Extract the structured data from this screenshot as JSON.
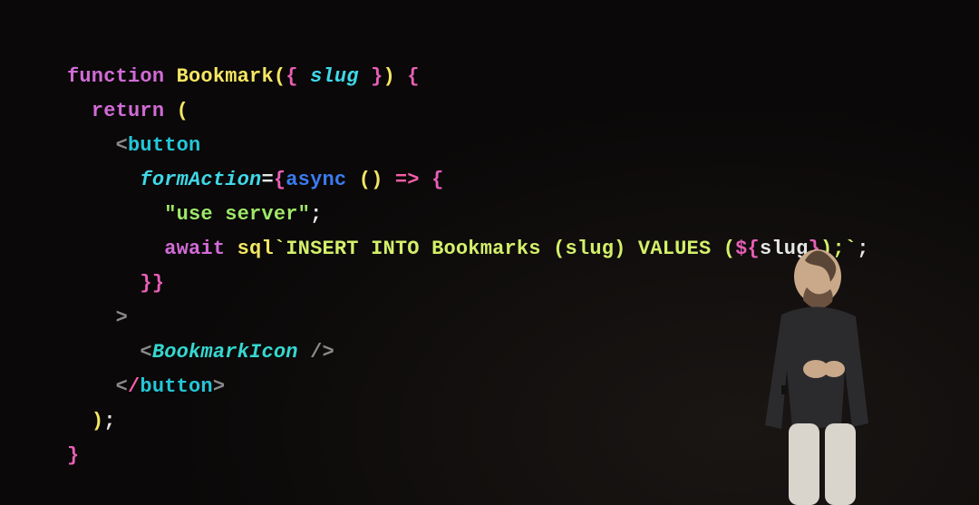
{
  "code": {
    "l1": {
      "kw_function": "function",
      "sp1": " ",
      "fn_name": "Bookmark",
      "paren_open": "(",
      "brace_open": "{ ",
      "param": "slug",
      "brace_close": " }",
      "paren_close": ")",
      "sp2": " ",
      "body_open": "{"
    },
    "l2": {
      "indent": "  ",
      "kw_return": "return",
      "sp": " ",
      "paren": "("
    },
    "l3": {
      "indent": "    ",
      "lt": "<",
      "tag": "button"
    },
    "l4": {
      "indent": "      ",
      "attr": "formAction",
      "eq": "=",
      "brace_o": "{",
      "async": "async",
      "sp": " ",
      "unit": "()",
      "sp2": " ",
      "arrow": "=>",
      "sp3": " ",
      "fn_brace": "{"
    },
    "l5": {
      "indent": "        ",
      "str": "\"use server\"",
      "semi": ";"
    },
    "l6": {
      "indent": "        ",
      "await": "await",
      "sp": " ",
      "sql": "sql",
      "tick1": "`",
      "tmpl": "INSERT INTO Bookmarks (slug) VALUES (",
      "dollar": "${",
      "var": "slug",
      "dollar_c": "}",
      "tmpl2": ");",
      "tick2": "`",
      "semi": ";"
    },
    "l7": {
      "indent": "      ",
      "close_inner": "}",
      "close_outer": "}"
    },
    "l8": {
      "indent": "    ",
      "gt": ">"
    },
    "l9": {
      "indent": "      ",
      "lt": "<",
      "comp": "BookmarkIcon",
      "sp": " ",
      "self_close": "/>"
    },
    "l10": {
      "indent": "    ",
      "lt": "<",
      "slash": "/",
      "tag": "button",
      "gt": ">"
    },
    "l11": {
      "indent": "  ",
      "paren": ")",
      "semi": ";"
    },
    "l12": {
      "brace": "}"
    }
  },
  "speaker": {
    "present": true,
    "description": "presenter-on-stage"
  }
}
